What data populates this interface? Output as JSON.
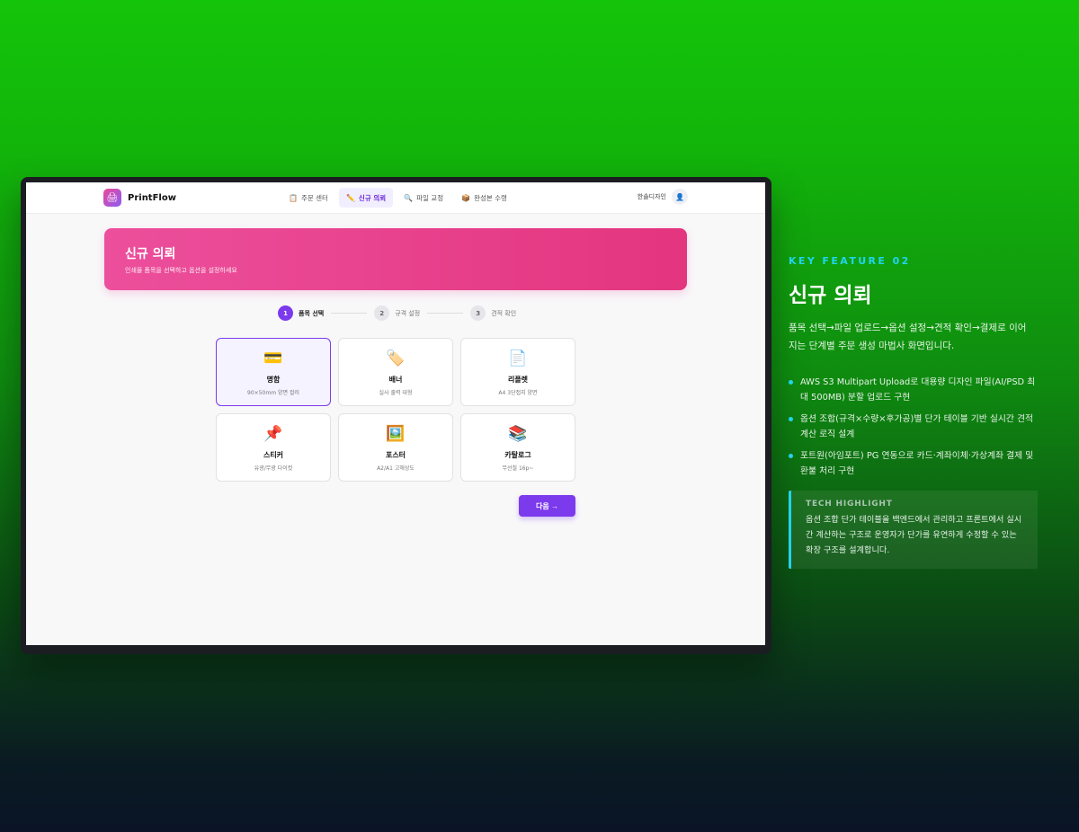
{
  "app": {
    "brand": "PrintFlow",
    "nav": [
      {
        "icon": "📋",
        "label": "주문 센터"
      },
      {
        "icon": "✏️",
        "label": "신규 의뢰"
      },
      {
        "icon": "🔍",
        "label": "파일 교정"
      },
      {
        "icon": "📦",
        "label": "완성본 수령"
      }
    ],
    "user": {
      "name": "한솔디자인",
      "avatar_icon": "👤"
    },
    "hero": {
      "title": "신규 의뢰",
      "subtitle": "인쇄물 품목을 선택하고 옵션을 설정하세요"
    },
    "steps": [
      {
        "num": "1",
        "label": "품목 선택"
      },
      {
        "num": "2",
        "label": "규격 설정"
      },
      {
        "num": "3",
        "label": "견적 확인"
      }
    ],
    "products": [
      {
        "icon": "💳",
        "title": "명함",
        "sub": "90×50mm 양면 컬러"
      },
      {
        "icon": "🏷️",
        "title": "배너",
        "sub": "실사 출력 대형"
      },
      {
        "icon": "📄",
        "title": "리플렛",
        "sub": "A4 3단접지 양면"
      },
      {
        "icon": "📌",
        "title": "스티커",
        "sub": "유광/무광 다이컷"
      },
      {
        "icon": "🖼️",
        "title": "포스터",
        "sub": "A2/A1 고해상도"
      },
      {
        "icon": "📚",
        "title": "카탈로그",
        "sub": "무선철 16p~"
      }
    ],
    "next_label": "다음 →"
  },
  "feature": {
    "label": "KEY FEATURE 02",
    "title": "신규 의뢰",
    "description": "품목 선택→파일 업로드→옵션 설정→견적 확인→결제로 이어지는 단계별 주문 생성 마법사 화면입니다.",
    "bullets": [
      "AWS S3 Multipart Upload로 대용량 디자인 파일(AI/PSD 최대 500MB) 분할 업로드 구현",
      "옵션 조합(규격×수량×후가공)별 단가 테이블 기반 실시간 견적 계산 로직 설계",
      "포트원(아임포트) PG 연동으로 카드·계좌이체·가상계좌 결제 및 환불 처리 구현"
    ],
    "tech_label": "TECH HIGHLIGHT",
    "tech_text": "옵션 조합 단가 테이블을 백엔드에서 관리하고 프론트에서 실시간 계산하는 구조로 운영자가 단가를 유연하게 수정할 수 있는 확장 구조를 설계합니다."
  },
  "colors": {
    "accent": "#7c3aed",
    "hero": "#e4357f",
    "feature_accent": "#22d3ee"
  }
}
